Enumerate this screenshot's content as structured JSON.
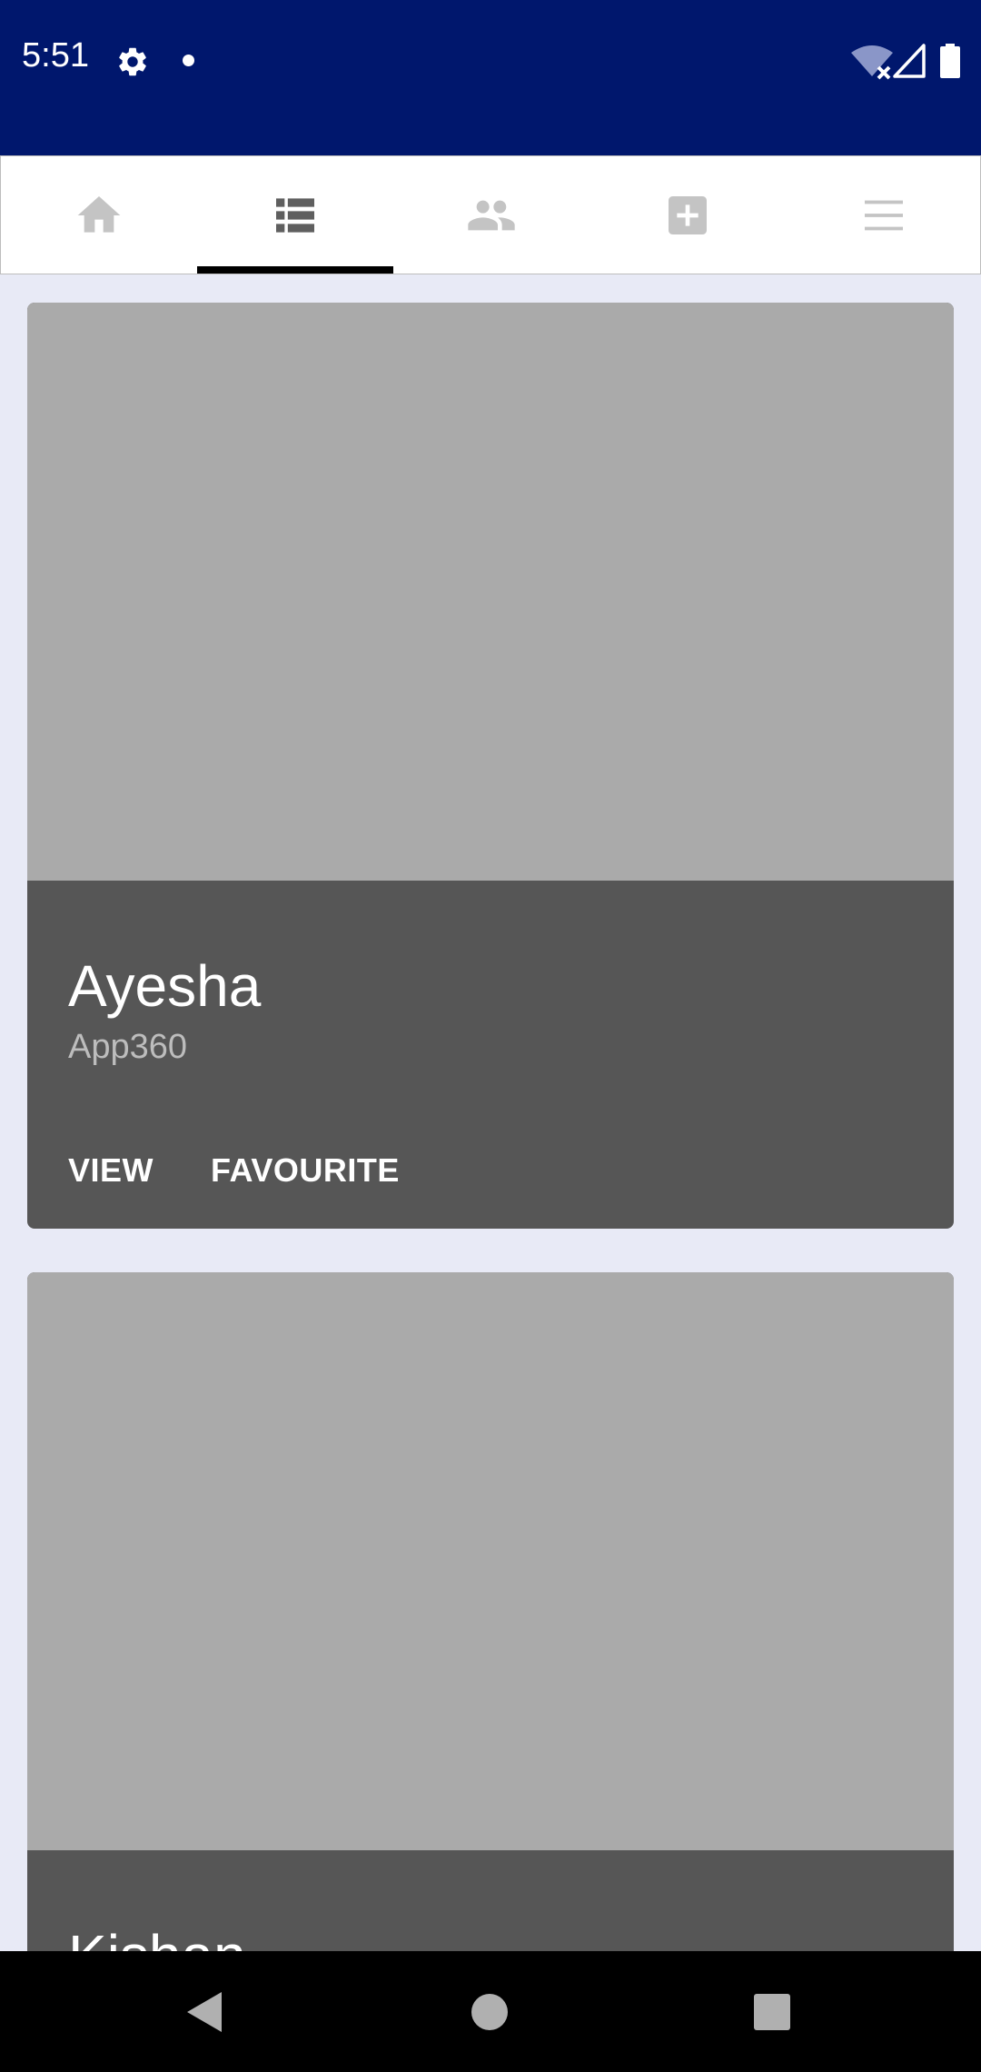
{
  "status_bar": {
    "time": "5:51",
    "background": "#00176d",
    "icons": [
      "settings-icon",
      "notification-dot-icon",
      "wifi-off-icon",
      "cell-signal-icon",
      "battery-icon"
    ]
  },
  "tabs": [
    {
      "name": "home",
      "icon": "home-icon",
      "active": false
    },
    {
      "name": "list",
      "icon": "list-icon",
      "active": true
    },
    {
      "name": "people",
      "icon": "people-icon",
      "active": false
    },
    {
      "name": "add",
      "icon": "add-box-icon",
      "active": false
    },
    {
      "name": "menu",
      "icon": "menu-icon",
      "active": false
    }
  ],
  "cards": [
    {
      "title": "Ayesha",
      "subtitle": "App360",
      "actions": [
        "VIEW",
        "FAVOURITE"
      ]
    },
    {
      "title": "Kishan"
    }
  ],
  "colors": {
    "page_background": "#e8eaf6",
    "card_image": "#aaaaaa",
    "card_footer": "#565656",
    "inactive_icon": "#c4c4c4",
    "active_icon": "#5f5f5f"
  },
  "nav_bar": {
    "buttons": [
      "back-icon",
      "home-circle-icon",
      "recents-icon"
    ]
  }
}
